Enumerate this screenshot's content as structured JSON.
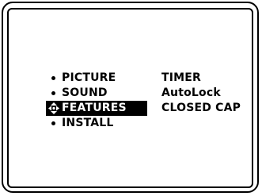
{
  "main_menu": {
    "items": [
      {
        "label": "PICTURE",
        "selected": false
      },
      {
        "label": "SOUND",
        "selected": false
      },
      {
        "label": "FEATURES",
        "selected": true
      },
      {
        "label": "INSTALL",
        "selected": false
      }
    ]
  },
  "submenu": {
    "items": [
      {
        "label": "TIMER"
      },
      {
        "label": "AutoLock"
      },
      {
        "label": "CLOSED CAP"
      }
    ]
  },
  "icons": {
    "bullet": "bullet-dot-icon",
    "selection": "four-way-navigation-arrows-icon"
  },
  "colors": {
    "background": "#ffffff",
    "foreground": "#000000",
    "highlight_bg": "#000000",
    "highlight_fg": "#ffffff"
  }
}
